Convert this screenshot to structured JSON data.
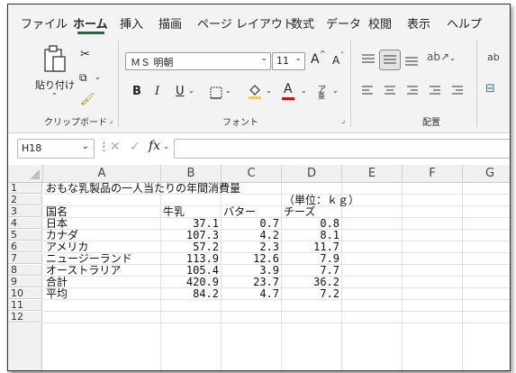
{
  "menu": [
    "ファイル",
    "ホーム",
    "挿入",
    "描画",
    "ページ レイアウト",
    "数式",
    "データ",
    "校閲",
    "表示",
    "ヘルプ"
  ],
  "ribbon": {
    "paste_label": "貼り付け",
    "clipboard_label": "クリップボード",
    "font_name": "ＭＳ 明朝",
    "font_size": "11",
    "grow_font": "A",
    "shrink_font": "A",
    "bold": "B",
    "italic": "I",
    "underline": "U",
    "font_color_letter": "A",
    "phonetic": "ア",
    "font_label": "フォント",
    "alignment_label": "配置",
    "cut_char": "ab"
  },
  "formula_bar": {
    "name_box": "H18",
    "fx": "fx",
    "formula": ""
  },
  "sheet": {
    "columns": [
      "A",
      "B",
      "C",
      "D",
      "E",
      "F",
      "G"
    ],
    "row_numbers": [
      "1",
      "2",
      "3",
      "4",
      "5",
      "6",
      "7",
      "8",
      "9",
      "10",
      "11",
      "12"
    ],
    "title": "おもな乳製品の一人当たりの年間消費量",
    "unit": "（単位：ｋｇ）",
    "headers": [
      "国名",
      "牛乳",
      "バター",
      "チーズ"
    ],
    "rows": [
      [
        "日本",
        "37.1",
        "0.7",
        "0.8"
      ],
      [
        "カナダ",
        "107.3",
        "4.2",
        "8.1"
      ],
      [
        "アメリカ",
        "57.2",
        "2.3",
        "11.7"
      ],
      [
        "ニュージーランド",
        "113.9",
        "12.6",
        "7.9"
      ],
      [
        "オーストラリア",
        "105.4",
        "3.9",
        "7.7"
      ],
      [
        "合計",
        "420.9",
        "23.7",
        "36.2"
      ],
      [
        "平均",
        "84.2",
        "4.7",
        "7.2"
      ]
    ]
  },
  "colors": {
    "accent": "#1e6b32",
    "font_highlight": "#ffd800",
    "font_red": "#d01010"
  }
}
